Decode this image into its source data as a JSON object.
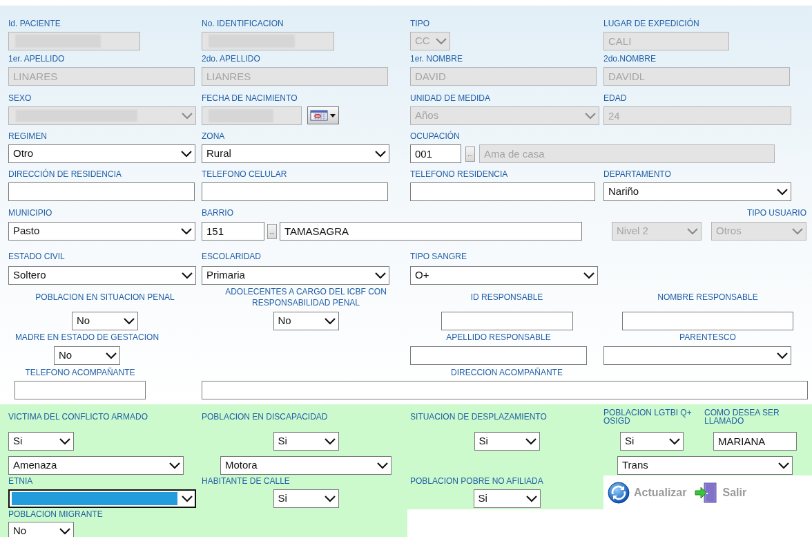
{
  "patient_form": {
    "rows": [
      {
        "fields": [
          {
            "label": "Id. PACIENTE",
            "controls": [
              {
                "kind": "text",
                "disabled": true,
                "redacted": true
              }
            ]
          },
          {
            "label": "No. IDENTIFICACION",
            "controls": [
              {
                "kind": "text",
                "disabled": true,
                "redacted": true
              }
            ]
          },
          {
            "label": "TIPO",
            "controls": [
              {
                "kind": "select",
                "value": "CC",
                "disabled": true,
                "redacted": false,
                "focused": false
              }
            ]
          },
          {
            "label": "LUGAR DE EXPEDICIÓN",
            "controls": [
              {
                "kind": "text",
                "value": "CALI",
                "disabled": true,
                "redacted": false
              }
            ]
          }
        ]
      },
      {
        "fields": [
          {
            "label": "1er. APELLIDO",
            "controls": [
              {
                "kind": "text",
                "value": "LINARES",
                "disabled": true,
                "redacted": false
              }
            ]
          },
          {
            "label": "2do. APELLIDO",
            "controls": [
              {
                "kind": "text",
                "value": "LIANRES",
                "disabled": true,
                "redacted": false
              }
            ]
          },
          {
            "label": "1er. NOMBRE",
            "controls": [
              {
                "kind": "text",
                "value": "DAVID",
                "disabled": true,
                "redacted": false
              }
            ]
          },
          {
            "label": "2do.NOMBRE",
            "controls": [
              {
                "kind": "text",
                "value": "DAVIDL",
                "disabled": true,
                "redacted": false
              }
            ]
          }
        ]
      },
      {
        "fields": [
          {
            "label": "SEXO",
            "controls": [
              {
                "kind": "select",
                "disabled": true,
                "redacted": true,
                "focused": false
              }
            ]
          },
          {
            "label": "FECHA DE NACIMIENTO",
            "controls": [
              {
                "kind": "text",
                "disabled": true,
                "redacted": true
              },
              {
                "kind": "calendar",
                "disabled": false
              }
            ]
          },
          {
            "label": "UNIDAD DE MEDIDA",
            "controls": [
              {
                "kind": "select",
                "value": "Años",
                "disabled": true,
                "redacted": false,
                "focused": false
              }
            ]
          },
          {
            "label": "EDAD",
            "controls": [
              {
                "kind": "text",
                "value": "24",
                "disabled": true,
                "redacted": false
              }
            ]
          }
        ]
      },
      {
        "fields": [
          {
            "label": "REGIMEN",
            "controls": [
              {
                "kind": "select",
                "value": "Otro",
                "disabled": false,
                "redacted": false,
                "focused": false
              }
            ]
          },
          {
            "label": "ZONA",
            "controls": [
              {
                "kind": "select",
                "value": "Rural",
                "disabled": false,
                "redacted": false,
                "focused": false
              }
            ]
          },
          {
            "label": "OCUPACIÓN",
            "controls": [
              {
                "kind": "text",
                "value": "001",
                "disabled": false,
                "redacted": false
              },
              {
                "kind": "button",
                "label": "...",
                "disabled": false
              },
              {
                "kind": "text",
                "value": "Ama de casa",
                "disabled": true,
                "redacted": false
              }
            ]
          }
        ]
      },
      {
        "fields": [
          {
            "label": "DIRECCIÓN DE RESIDENCIA",
            "controls": [
              {
                "kind": "text",
                "disabled": false,
                "redacted": false
              }
            ]
          },
          {
            "label": "TELEFONO CELULAR",
            "controls": [
              {
                "kind": "text",
                "disabled": false,
                "redacted": false
              }
            ]
          },
          {
            "label": "TELEFONO RESIDENCIA",
            "controls": [
              {
                "kind": "text",
                "disabled": false,
                "redacted": false
              }
            ]
          },
          {
            "label": "DEPARTAMENTO",
            "controls": [
              {
                "kind": "select",
                "value": "Nariño",
                "disabled": false,
                "redacted": false,
                "focused": false
              }
            ]
          }
        ]
      },
      {
        "fields": [
          {
            "label": "MUNICIPIO",
            "controls": [
              {
                "kind": "select",
                "value": "Pasto",
                "disabled": false,
                "redacted": false,
                "focused": false
              }
            ]
          },
          {
            "label": "BARRIO",
            "controls": [
              {
                "kind": "text",
                "value": "151",
                "disabled": false,
                "redacted": false
              },
              {
                "kind": "button",
                "label": "...",
                "disabled": false
              },
              {
                "kind": "text",
                "value": "TAMASAGRA",
                "disabled": false,
                "redacted": false
              }
            ]
          },
          {
            "controls": [
              {
                "kind": "select",
                "value": "Nivel 2",
                "disabled": true,
                "redacted": false,
                "focused": false
              }
            ]
          },
          {
            "label": "TIPO USUARIO",
            "controls": [
              {
                "kind": "select",
                "value": "Otros",
                "disabled": true,
                "redacted": false,
                "focused": false
              }
            ]
          }
        ]
      },
      {
        "fields": [
          {
            "label": "ESTADO CIVIL",
            "controls": [
              {
                "kind": "select",
                "value": "Soltero",
                "disabled": false,
                "redacted": false,
                "focused": false
              }
            ]
          },
          {
            "label": "ESCOLARIDAD",
            "controls": [
              {
                "kind": "select",
                "value": "Primaria",
                "disabled": false,
                "redacted": false,
                "focused": false
              }
            ]
          },
          {
            "label": "TIPO SANGRE",
            "controls": [
              {
                "kind": "select",
                "value": "O+",
                "disabled": false,
                "redacted": false,
                "focused": false
              }
            ]
          }
        ]
      },
      {
        "fields": [
          {
            "label": "POBLACION EN SITUACION PENAL",
            "controls": [
              {
                "kind": "select",
                "value": "No",
                "disabled": false,
                "redacted": false,
                "focused": false
              }
            ]
          },
          {
            "label": "ADOLECENTES A CARGO DEL ICBF CON RESPONSABILIDAD PENAL",
            "controls": [
              {
                "kind": "select",
                "value": "No",
                "disabled": false,
                "redacted": false,
                "focused": false
              }
            ]
          },
          {
            "label": "ID RESPONSABLE",
            "controls": [
              {
                "kind": "text",
                "disabled": false,
                "redacted": false
              }
            ]
          },
          {
            "label": "NOMBRE RESPONSABLE",
            "controls": [
              {
                "kind": "text",
                "disabled": false,
                "redacted": false
              }
            ]
          }
        ]
      },
      {
        "fields": [
          {
            "label": "MADRE EN ESTADO DE GESTACION",
            "controls": [
              {
                "kind": "select",
                "value": "No",
                "disabled": false,
                "redacted": false,
                "focused": false
              }
            ]
          },
          {
            "label": "APELLIDO RESPONSABLE",
            "controls": [
              {
                "kind": "text",
                "disabled": false,
                "redacted": false
              }
            ]
          },
          {
            "label": "PARENTESCO",
            "controls": [
              {
                "kind": "select",
                "disabled": false,
                "redacted": false,
                "focused": false
              }
            ]
          }
        ]
      },
      {
        "fields": [
          {
            "label": "TELEFONO ACOMPAÑANTE",
            "controls": [
              {
                "kind": "text",
                "disabled": false,
                "redacted": false
              }
            ]
          },
          {
            "label": "DIRECCION ACOMPAÑANTE",
            "controls": [
              {
                "kind": "text",
                "disabled": false,
                "redacted": false
              }
            ]
          }
        ]
      }
    ]
  },
  "population_section": {
    "rows": [
      {
        "fields": [
          {
            "label": "VICTIMA DEL CONFLICTO ARMADO",
            "controls": [
              {
                "kind": "select",
                "value": "Si",
                "disabled": false,
                "redacted": false,
                "focused": false
              },
              {
                "kind": "select",
                "value": "Amenaza",
                "disabled": false,
                "redacted": false,
                "focused": false
              }
            ]
          },
          {
            "label": "POBLACION EN DISCAPACIDAD",
            "controls": [
              {
                "kind": "select",
                "value": "Si",
                "disabled": false,
                "redacted": false,
                "focused": false
              },
              {
                "kind": "select",
                "value": "Motora",
                "disabled": false,
                "redacted": false,
                "focused": false
              }
            ]
          },
          {
            "label": "SITUACION DE DESPLAZAMIENTO",
            "controls": [
              {
                "kind": "select",
                "value": "Si",
                "disabled": false,
                "redacted": false,
                "focused": false
              }
            ]
          },
          {
            "label": "POBLACION LGTBI Q+ OSIGD",
            "controls": [
              {
                "kind": "select",
                "value": "Si",
                "disabled": false,
                "redacted": false,
                "focused": false
              },
              {
                "kind": "select",
                "value": "Trans",
                "disabled": false,
                "redacted": false,
                "focused": false
              }
            ]
          },
          {
            "label": "COMO DESEA SER LLAMADO",
            "controls": [
              {
                "kind": "text",
                "value": "MARIANA",
                "disabled": false,
                "redacted": false
              }
            ]
          }
        ]
      },
      {
        "fields": [
          {
            "label": "ETNIA",
            "controls": [
              {
                "kind": "select",
                "disabled": false,
                "redacted": false,
                "focused": true
              }
            ]
          },
          {
            "label": "HABITANTE DE CALLE",
            "controls": [
              {
                "kind": "select",
                "value": "Si",
                "disabled": false,
                "redacted": false,
                "focused": false
              }
            ]
          },
          {
            "label": "POBLACION POBRE NO AFILIADA",
            "controls": [
              {
                "kind": "select",
                "value": "Si",
                "disabled": false,
                "redacted": false,
                "focused": false
              }
            ]
          }
        ]
      },
      {
        "fields": [
          {
            "label": "POBLACION MIGRANTE",
            "controls": [
              {
                "kind": "select",
                "value": "No",
                "disabled": false,
                "redacted": false,
                "focused": false
              }
            ]
          }
        ]
      }
    ]
  },
  "actions": [
    {
      "kind": "refresh",
      "label": "Actualizar"
    },
    {
      "kind": "exit",
      "label": "Salir"
    }
  ]
}
